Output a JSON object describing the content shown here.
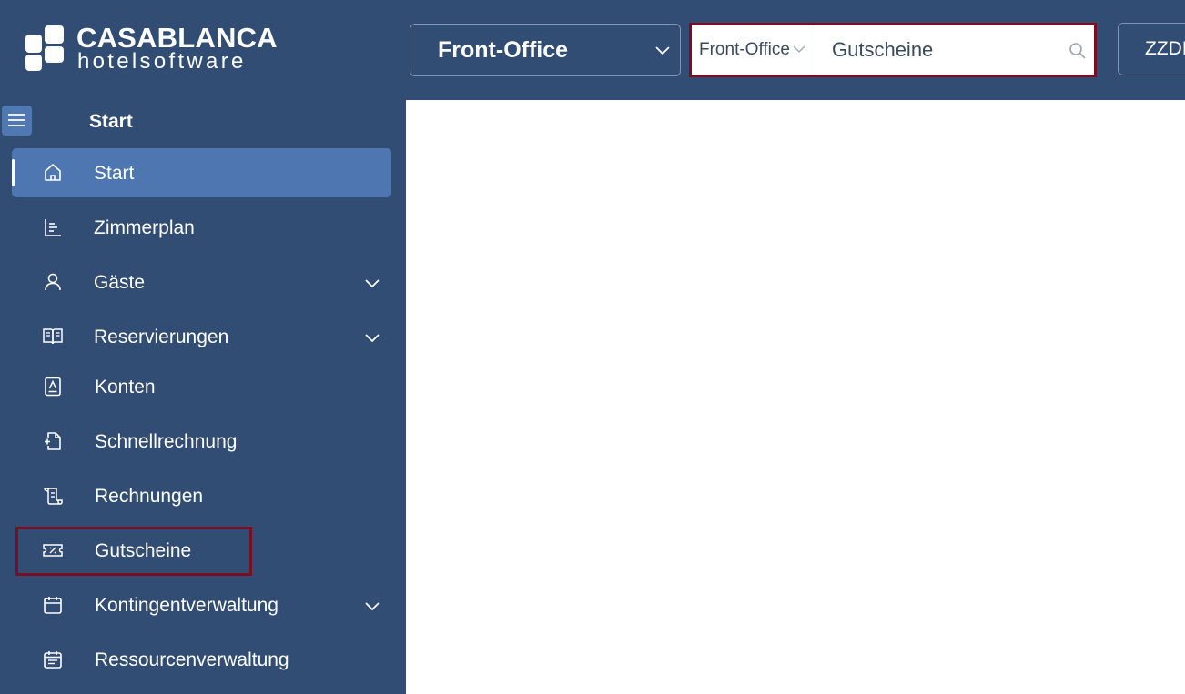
{
  "app": {
    "logo_main": "CASABLANCA",
    "logo_sub": "hotelsoftware"
  },
  "header": {
    "module_select": "Front-Office",
    "search": {
      "scope": "Front-Office",
      "value": "Gutscheine"
    },
    "user_button": "ZZDE"
  },
  "sidebar": {
    "title": "Start",
    "items": [
      {
        "label": "Start",
        "icon": "home-icon",
        "active": true
      },
      {
        "label": "Zimmerplan",
        "icon": "chart-list-icon"
      },
      {
        "label": "Gäste",
        "icon": "user-icon",
        "expandable": true
      },
      {
        "label": "Reservierungen",
        "icon": "book-icon",
        "expandable": true
      },
      {
        "label": "Konten",
        "icon": "account-icon"
      },
      {
        "label": "Schnellrechnung",
        "icon": "file-plus-icon"
      },
      {
        "label": "Rechnungen",
        "icon": "receipt-icon"
      },
      {
        "label": "Gutscheine",
        "icon": "voucher-icon"
      },
      {
        "label": "Kontingentverwaltung",
        "icon": "calendar-icon",
        "expandable": true
      },
      {
        "label": "Ressourcenverwaltung",
        "icon": "calendar-list-icon"
      }
    ]
  },
  "colors": {
    "primary": "#314d74",
    "active_item": "#4e76b0",
    "highlight": "#7a0d21"
  }
}
